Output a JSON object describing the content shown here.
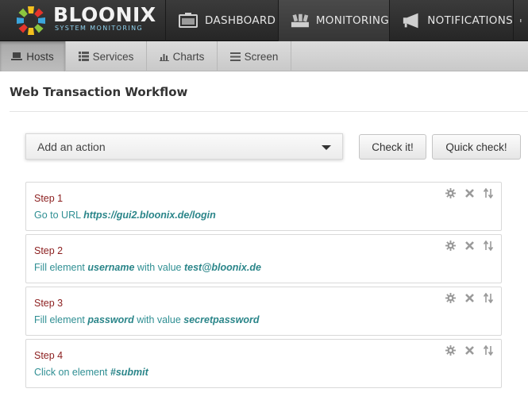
{
  "brand": {
    "name": "BLOONIX",
    "tagline": "SYSTEM MONITORING"
  },
  "topnav": [
    {
      "label": "DASHBOARD",
      "icon": "dashboard-icon",
      "active": false
    },
    {
      "label": "MONITORING",
      "icon": "monitoring-icon",
      "active": true
    },
    {
      "label": "NOTIFICATIONS",
      "icon": "megaphone-icon",
      "active": false
    }
  ],
  "subnav": [
    {
      "label": "Hosts",
      "icon": "laptop-icon",
      "active": true
    },
    {
      "label": "Services",
      "icon": "list-icon",
      "active": false
    },
    {
      "label": "Charts",
      "icon": "bar-chart-icon",
      "active": false
    },
    {
      "label": "Screen",
      "icon": "screen-icon",
      "active": false
    }
  ],
  "page": {
    "title": "Web Transaction Workflow"
  },
  "action_select": {
    "value": "Add an action"
  },
  "buttons": {
    "check": "Check it!",
    "quick_check": "Quick check!"
  },
  "steps": [
    {
      "title": "Step 1",
      "parts": [
        {
          "t": "Go to URL "
        },
        {
          "t": "https://gui2.bloonix.de/login",
          "b": true
        }
      ]
    },
    {
      "title": "Step 2",
      "parts": [
        {
          "t": "Fill element "
        },
        {
          "t": "username",
          "b": true
        },
        {
          "t": " with value "
        },
        {
          "t": "test@bloonix.de",
          "b": true
        }
      ]
    },
    {
      "title": "Step 3",
      "parts": [
        {
          "t": "Fill element "
        },
        {
          "t": "password",
          "b": true
        },
        {
          "t": " with value "
        },
        {
          "t": "secretpassword",
          "b": true
        }
      ]
    },
    {
      "title": "Step 4",
      "parts": [
        {
          "t": "Click on element "
        },
        {
          "t": "#submit",
          "b": true
        }
      ]
    }
  ],
  "step_tools": [
    "gear-icon",
    "close-icon",
    "sort-icon"
  ],
  "colors": {
    "step_title": "#8b1e1e",
    "step_text": "#2f8f93",
    "topbar": "#2e2e2e",
    "subnav": "#d2d2d2"
  }
}
